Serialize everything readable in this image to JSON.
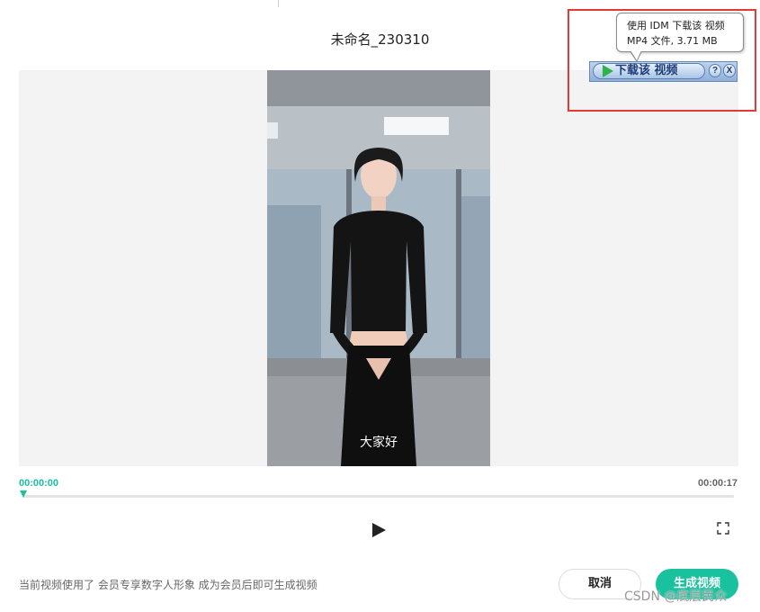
{
  "dialog": {
    "title": "未命名_230310"
  },
  "video": {
    "subtitle": "大家好"
  },
  "player": {
    "current_time": "00:00:00",
    "total_time": "00:00:17",
    "progress": 0,
    "play_icon": "play-icon",
    "fullscreen_icon": "fullscreen-icon"
  },
  "footer": {
    "notice": "当前视频使用了 会员专享数字人形象 成为会员后即可生成视频",
    "cancel_label": "取消",
    "generate_label": "生成视频"
  },
  "idm": {
    "tooltip_line1": "使用 IDM 下载该 视频",
    "tooltip_line2": "MP4 文件, 3.71 MB",
    "download_label": "下载该 视频",
    "help_label": "?",
    "close_label": "X"
  },
  "watermark": "CSDN @底层民众",
  "colors": {
    "accent": "#19c19e",
    "highlight_border": "#e53935"
  }
}
